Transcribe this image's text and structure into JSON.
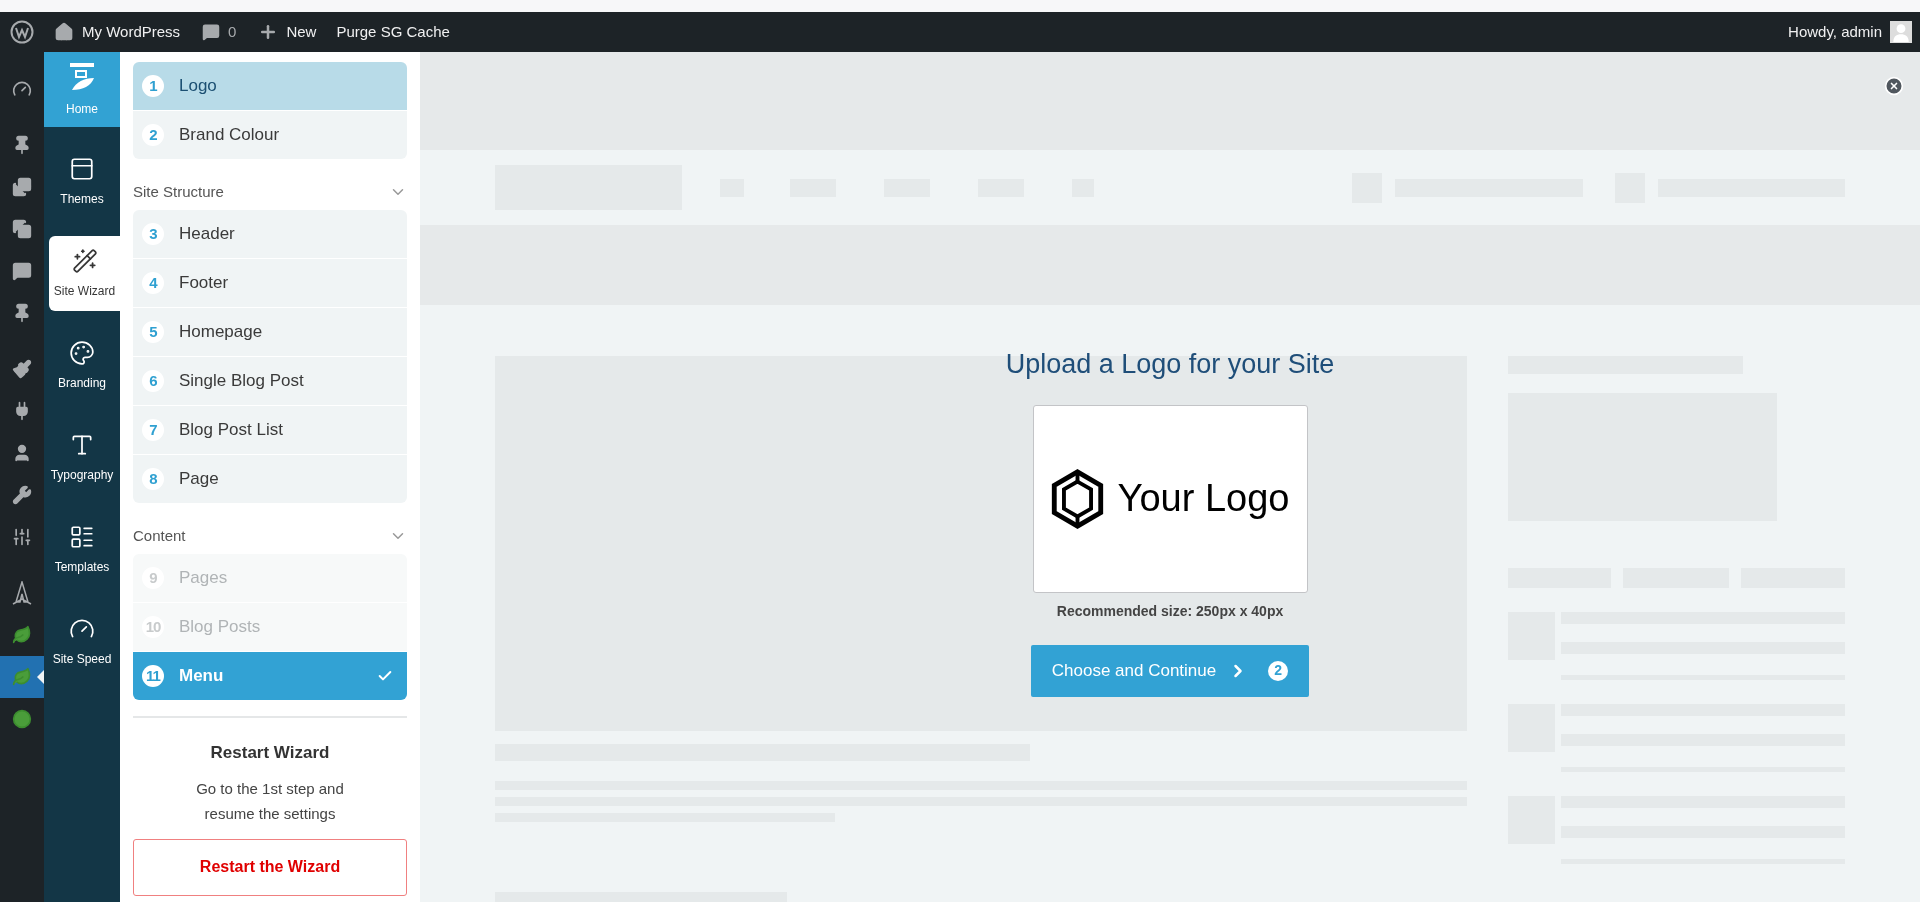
{
  "admin_bar": {
    "site": "My WordPress",
    "comments": "0",
    "new": "New",
    "purge": "Purge SG Cache",
    "greeting": "Howdy, admin"
  },
  "admin_menu": [
    {
      "selected": false
    },
    {
      "selected": false
    },
    {
      "selected": false
    },
    {
      "selected": false
    },
    {
      "selected": false
    },
    {
      "selected": false
    },
    {
      "selected": false
    },
    {
      "selected": false
    },
    {
      "selected": false
    },
    {
      "selected": false
    },
    {
      "selected": false
    },
    {
      "selected": false
    },
    {
      "selected": false
    },
    {
      "selected": true
    },
    {
      "selected": false
    }
  ],
  "plugin_nav": [
    {
      "label": "Home",
      "highlighted": true,
      "selected": false
    },
    {
      "label": "Themes",
      "highlighted": false,
      "selected": false
    },
    {
      "label": "Site Wizard",
      "highlighted": false,
      "selected": true
    },
    {
      "label": "Branding",
      "highlighted": false,
      "selected": false
    },
    {
      "label": "Typography",
      "highlighted": false,
      "selected": false
    },
    {
      "label": "Templates",
      "highlighted": false,
      "selected": false
    },
    {
      "label": "Site Speed",
      "highlighted": false,
      "selected": false
    }
  ],
  "wizard": {
    "groups": [
      {
        "steps": [
          {
            "number": "1",
            "label": "Logo",
            "selected": true,
            "completed": false,
            "disabled": false
          },
          {
            "number": "2",
            "label": "Brand Colour",
            "selected": false,
            "completed": false,
            "disabled": false
          }
        ]
      },
      {
        "title": "Site Structure",
        "expanded": true,
        "steps": [
          {
            "number": "3",
            "label": "Header",
            "selected": false,
            "completed": false,
            "disabled": false
          },
          {
            "number": "4",
            "label": "Footer",
            "selected": false,
            "completed": false,
            "disabled": false
          },
          {
            "number": "5",
            "label": "Homepage",
            "selected": false,
            "completed": false,
            "disabled": false
          },
          {
            "number": "6",
            "label": "Single Blog Post",
            "selected": false,
            "completed": false,
            "disabled": false
          },
          {
            "number": "7",
            "label": "Blog Post List",
            "selected": false,
            "completed": false,
            "disabled": false
          },
          {
            "number": "8",
            "label": "Page",
            "selected": false,
            "completed": false,
            "disabled": false
          }
        ]
      },
      {
        "title": "Content",
        "expanded": true,
        "steps": [
          {
            "number": "9",
            "label": "Pages",
            "selected": false,
            "completed": false,
            "disabled": true
          },
          {
            "number": "10",
            "label": "Blog Posts",
            "selected": false,
            "completed": false,
            "disabled": true
          },
          {
            "number": "11",
            "label": "Menu",
            "selected": false,
            "completed": true,
            "disabled": false
          }
        ]
      }
    ],
    "restart": {
      "title": "Restart Wizard",
      "text": "Go to the 1st step and resume the settings",
      "button": "Restart the Wizard"
    }
  },
  "upload": {
    "title": "Upload a Logo for your Site",
    "logo_text": "Your Logo",
    "hint": "Recommended size: 250px x 40px",
    "button": "Choose and Continue",
    "button_step": "2"
  }
}
